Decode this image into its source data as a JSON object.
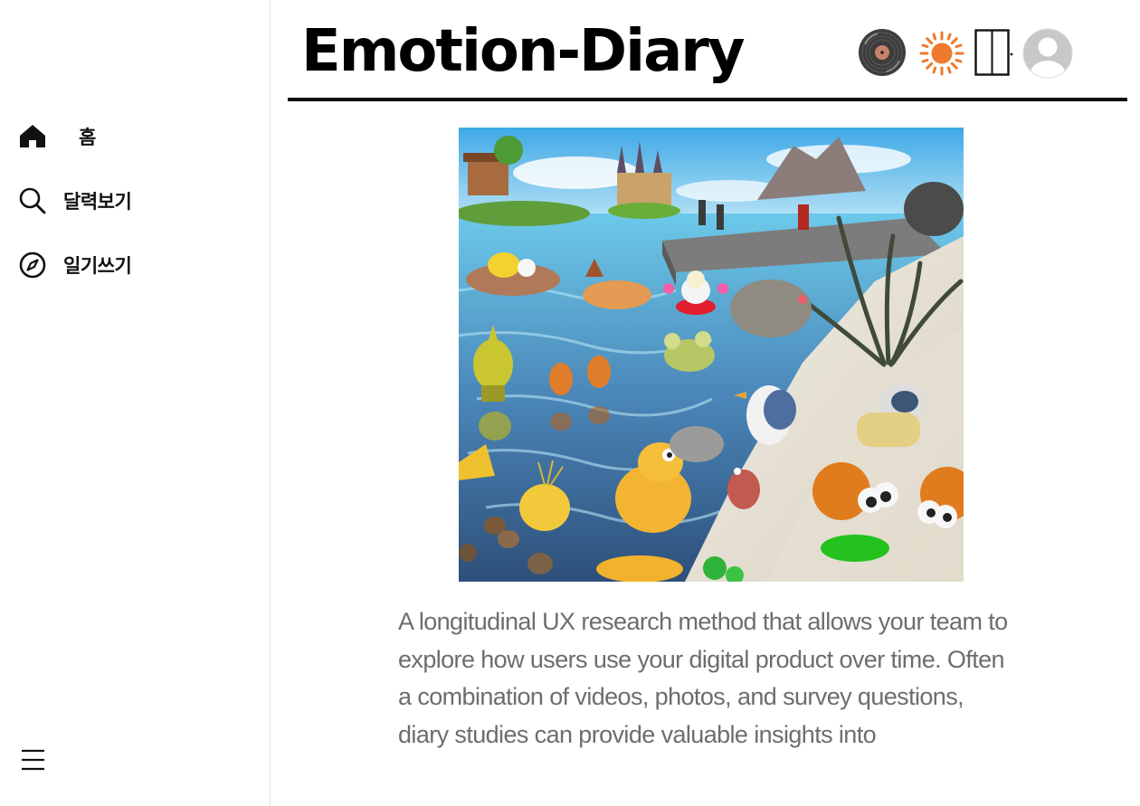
{
  "app": {
    "title": "Emotion-Diary"
  },
  "sidebar": {
    "items": [
      {
        "label": "홈",
        "icon": "home-icon"
      },
      {
        "label": "달력보기",
        "icon": "search-icon"
      },
      {
        "label": "일기쓰기",
        "icon": "compass-icon"
      }
    ],
    "menu_icon": "hamburger-menu-icon"
  },
  "header": {
    "icons": [
      "vinyl-record-icon",
      "sun-icon",
      "door-icon",
      "user-avatar-icon"
    ],
    "colors": {
      "sun": "#ee7a2e",
      "vinyl": "#4a4a4a",
      "avatar": "#c8c8c8"
    }
  },
  "main": {
    "image": {
      "description_icon": "beach-illustration"
    },
    "description": "A longitudinal UX research method that allows your team to  explore how users use your digital product over time. Often a combination of videos, photos, and survey questions, diary studies can provide valuable insights into"
  }
}
